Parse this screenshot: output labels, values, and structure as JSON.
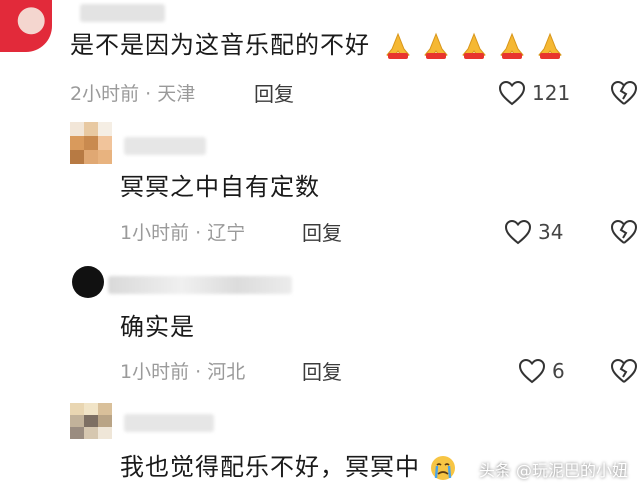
{
  "comments": [
    {
      "text": "是不是因为这音乐配的不好",
      "time": "2小时前",
      "location": "天津",
      "reply_label": "回复",
      "likes": "121",
      "reactions": [
        "pray-icon",
        "pray-icon",
        "pray-icon",
        "pray-icon",
        "pray-icon"
      ]
    },
    {
      "text": "冥冥之中自有定数",
      "time": "1小时前",
      "location": "辽宁",
      "reply_label": "回复",
      "likes": "34"
    },
    {
      "text": "确实是",
      "time": "1小时前",
      "location": "河北",
      "reply_label": "回复",
      "likes": "6"
    },
    {
      "text": "我也觉得配乐不好，冥冥中",
      "reaction": "crying-face-icon"
    }
  ],
  "separator": "·",
  "watermark": "头条 @玩泥巴的小妞",
  "colors": {
    "text": "#1a1a1a",
    "meta": "#9a9a9a",
    "icon": "#333333",
    "accent": "#e22a3a"
  }
}
